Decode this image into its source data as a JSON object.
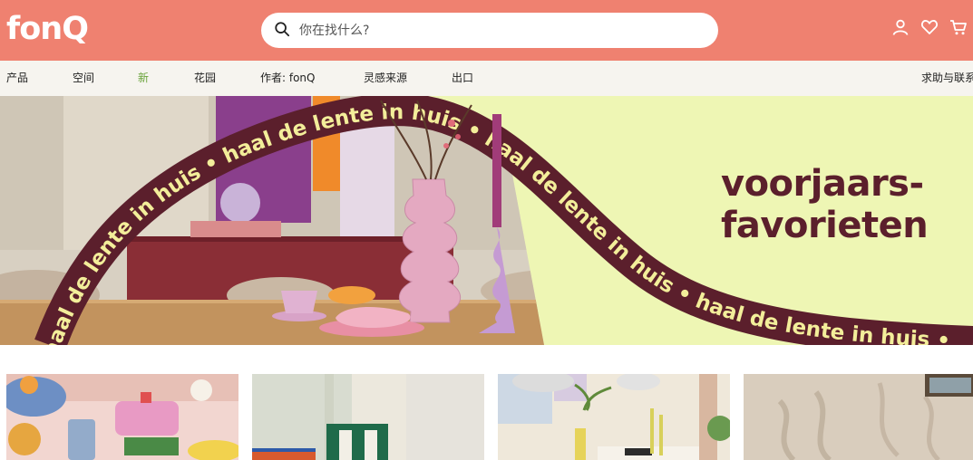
{
  "brand": {
    "logo": "fonQ"
  },
  "search": {
    "placeholder": "你在找什么?"
  },
  "header_icons": [
    "user-icon",
    "heart-icon",
    "cart-icon"
  ],
  "nav": {
    "items": [
      {
        "label": "产品"
      },
      {
        "label": "空间"
      },
      {
        "label": "新"
      },
      {
        "label": "花园"
      },
      {
        "label": "作者: fonQ"
      },
      {
        "label": "灵感来源"
      },
      {
        "label": "出口"
      }
    ],
    "help": "求助与联系"
  },
  "hero": {
    "title_line1": "voorjaars-",
    "title_line2": "favorieten",
    "ribbon_text": "haal de lente in huis • haal de lente in huis • haal de lente in huis • haal de lente in huis •"
  },
  "colors": {
    "header": "#ef8170",
    "nav_bg": "#f6f4ef",
    "nav_new": "#6aa33b",
    "hero_bg": "#eef6b4",
    "ribbon": "#5b1f2c",
    "ribbon_text": "#f3ee9a"
  }
}
